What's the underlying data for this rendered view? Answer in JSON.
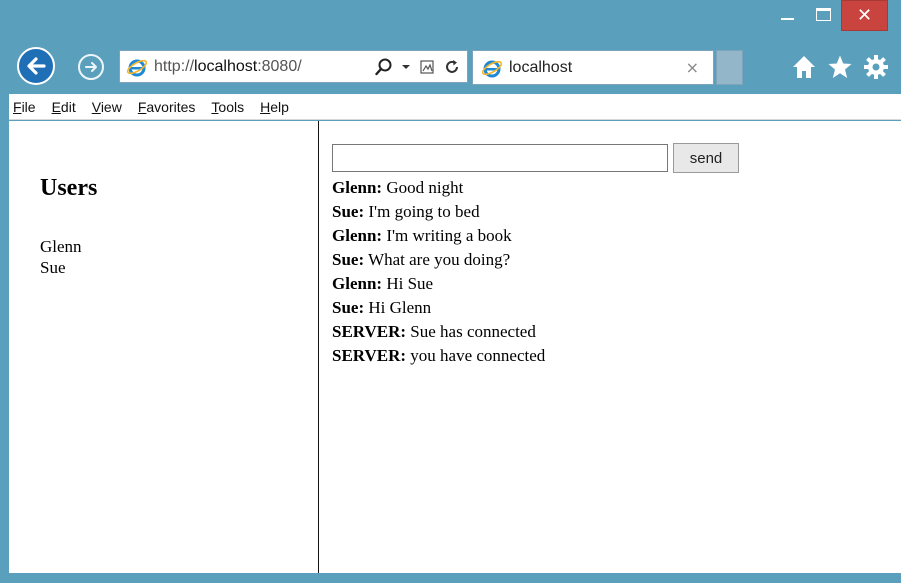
{
  "window": {
    "minimize_icon": "minimize-icon",
    "maximize_icon": "maximize-icon",
    "close_glyph": "✕"
  },
  "nav": {
    "url_prefix": "http://",
    "url_host": "localhost",
    "url_suffix": ":8080/",
    "tab_title": "localhost",
    "tab_close": "×"
  },
  "menu": {
    "items": [
      "File",
      "Edit",
      "View",
      "Favorites",
      "Tools",
      "Help"
    ]
  },
  "users": {
    "heading": "Users",
    "list": [
      "Glenn",
      "Sue"
    ]
  },
  "chat": {
    "input_value": "",
    "send_label": "send",
    "messages": [
      {
        "sender": "Glenn:",
        "text": " Good night"
      },
      {
        "sender": "Sue:",
        "text": " I'm going to bed"
      },
      {
        "sender": "Glenn:",
        "text": " I'm writing a book"
      },
      {
        "sender": "Sue:",
        "text": " What are you doing?"
      },
      {
        "sender": "Glenn:",
        "text": " Hi Sue"
      },
      {
        "sender": "Sue:",
        "text": " Hi Glenn"
      },
      {
        "sender": "SERVER:",
        "text": " Sue has connected"
      },
      {
        "sender": "SERVER:",
        "text": " you have connected"
      }
    ]
  },
  "colors": {
    "frame": "#5aa0bd",
    "back_button": "#1f6fb7",
    "close_button": "#c9443f",
    "ie_logo": "#1e88d6"
  }
}
